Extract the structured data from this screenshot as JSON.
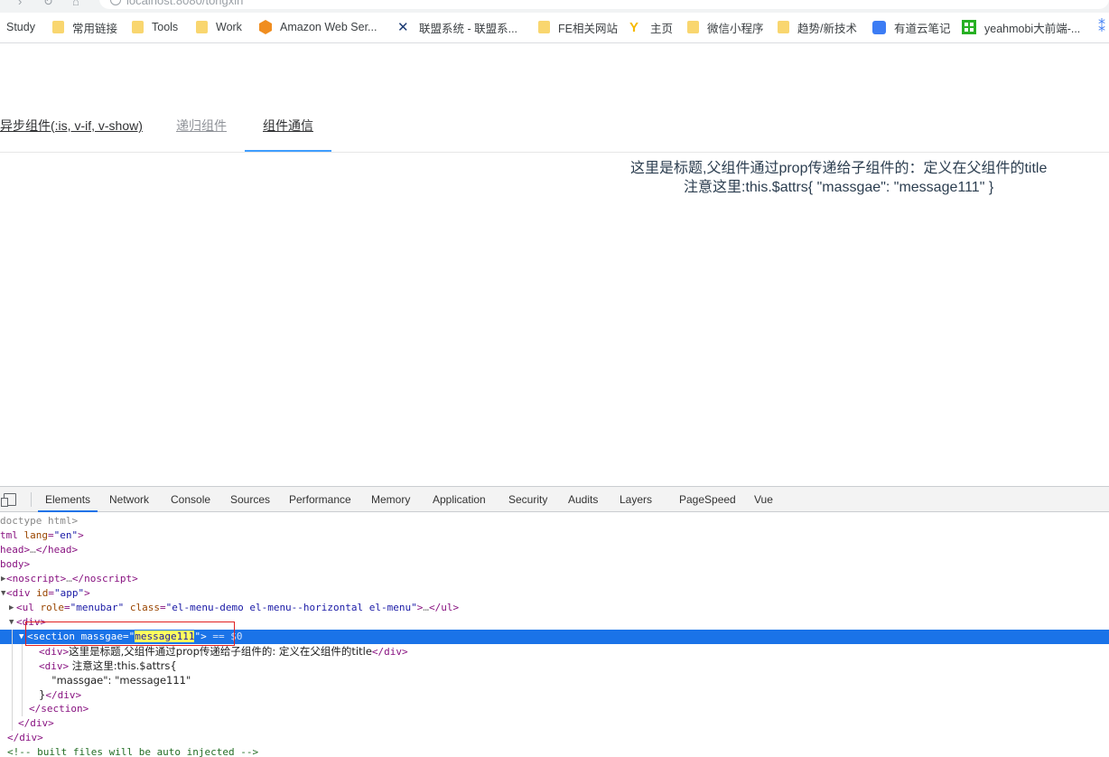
{
  "browser": {
    "url_text": "localhost:8080/tongxin",
    "bookmarks": [
      {
        "label": "Study",
        "icon": "none"
      },
      {
        "label": "常用链接",
        "icon": "folder-icon"
      },
      {
        "label": "Tools",
        "icon": "folder-icon"
      },
      {
        "label": "Work",
        "icon": "folder-icon"
      },
      {
        "label": "Amazon Web Ser...",
        "icon": "aws-icon"
      },
      {
        "label": "联盟系统 - 联盟系...",
        "icon": "x-logo-icon"
      },
      {
        "label": "FE相关网站",
        "icon": "folder-icon"
      },
      {
        "label": "主页",
        "icon": "y-logo-icon"
      },
      {
        "label": "微信小程序",
        "icon": "folder-icon"
      },
      {
        "label": "趋势/新技术",
        "icon": "folder-icon"
      },
      {
        "label": "有道云笔记",
        "icon": "note-icon"
      },
      {
        "label": "yeahmobi大前端-...",
        "icon": "grid-icon"
      }
    ]
  },
  "menu": {
    "items": [
      {
        "label": "异步组件(:is, v-if, v-show)",
        "state": "normal"
      },
      {
        "label": "递归组件",
        "state": "disabled"
      },
      {
        "label": "组件通信",
        "state": "active"
      }
    ],
    "accent": "#409eff"
  },
  "content": {
    "line1": "这里是标题,父组件通过prop传递给子组件的：定义在父组件的title",
    "line2": "注意这里:this.$attrs{ \"massgae\": \"message111\" }"
  },
  "devtools": {
    "tabs": [
      "Elements",
      "Network",
      "Console",
      "Sources",
      "Performance",
      "Memory",
      "Application",
      "Security",
      "Audits",
      "Layers",
      "PageSpeed",
      "Vue"
    ],
    "active_tab": "Elements",
    "dom": {
      "doctype": "doctype html>",
      "html_open_tag": "tml",
      "html_attr": "lang",
      "html_val": "\"en\"",
      "head_tag": "head",
      "head_ellipsis": "…",
      "head_close": "</head>",
      "body_tag": "body",
      "noscript_open": "<noscript>",
      "noscript_ellipsis": "…",
      "noscript_close": "</noscript>",
      "div_app_tag": "<div",
      "div_app_attr": "id",
      "div_app_val": "\"app\"",
      "ul_tag": "<ul",
      "ul_attr1": "role",
      "ul_val1": "\"menubar\"",
      "ul_attr2": "class",
      "ul_val2": "\"el-menu-demo el-menu--horizontal el-menu\"",
      "ul_ellipsis": "…",
      "ul_close": "</ul>",
      "div_open": "<div>",
      "section_tag": "<section",
      "section_attr": "massgae",
      "section_val_q1": "=\"",
      "section_val": "message111",
      "section_val_q2": "\">",
      "section_eq": " == $0",
      "child1_open": "<div>",
      "child1_text": "这里是标题,父组件通过prop传递给子组件的: 定义在父组件的title",
      "child1_close": "</div>",
      "child2_open": "<div>",
      "child2_text1": " 注意这里:this.$attrs{",
      "child2_text2": "  \"massgae\": \"message111\"",
      "child2_text3": "}",
      "child2_close": "</div>",
      "section_close": "</section>",
      "div_close": "</div>",
      "div_app_close": "</div>",
      "comment": "<!-- built files will be auto injected -->"
    },
    "selection_color": "#1a73e8"
  }
}
